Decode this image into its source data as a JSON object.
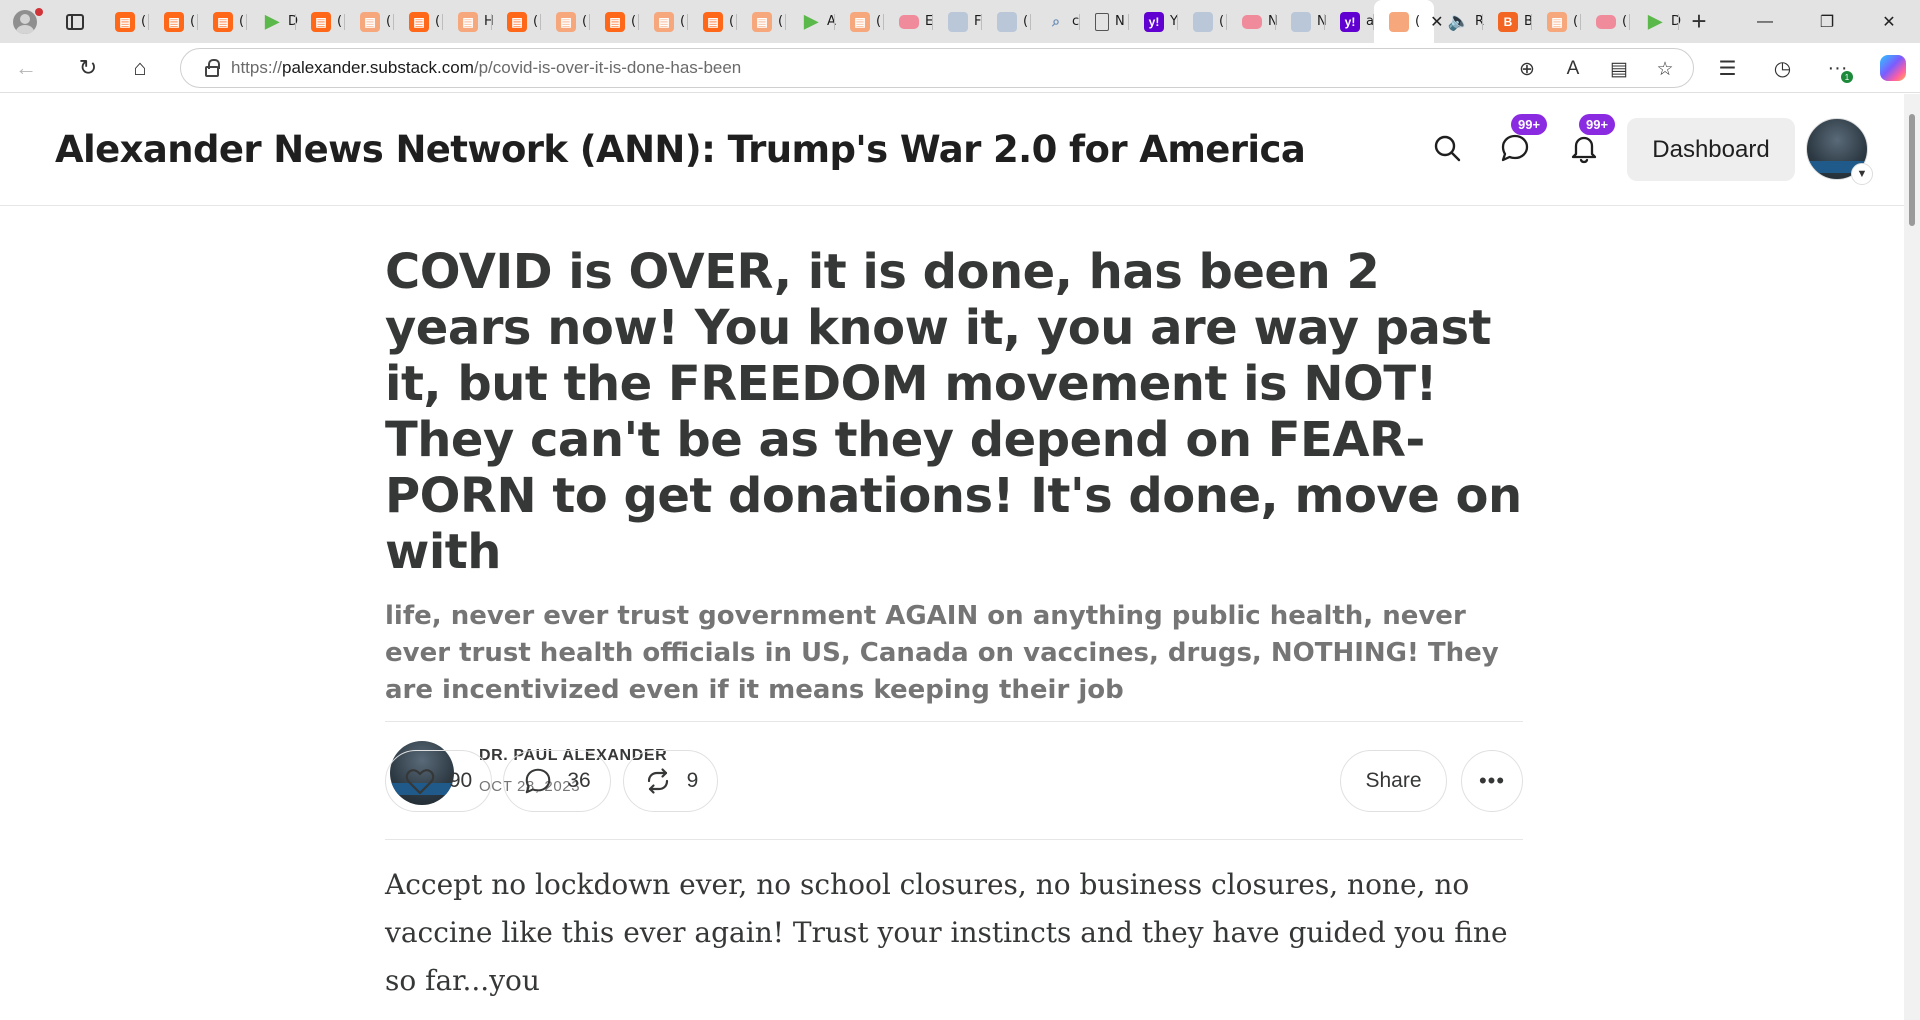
{
  "browser": {
    "tabs": [
      {
        "icon": "substack-icon",
        "letter": "("
      },
      {
        "icon": "substack-icon",
        "letter": "("
      },
      {
        "icon": "substack-icon",
        "letter": "("
      },
      {
        "icon": "play-icon",
        "letter": "D"
      },
      {
        "icon": "substack-icon",
        "letter": "("
      },
      {
        "icon": "substack-icon",
        "letter": "("
      },
      {
        "icon": "substack-icon",
        "letter": "("
      },
      {
        "icon": "substack-icon",
        "letter": "H"
      },
      {
        "icon": "substack-icon",
        "letter": "("
      },
      {
        "icon": "substack-icon",
        "letter": "("
      },
      {
        "icon": "substack-icon",
        "letter": "("
      },
      {
        "icon": "substack-icon",
        "letter": "("
      },
      {
        "icon": "substack-icon",
        "letter": "("
      },
      {
        "icon": "substack-icon",
        "letter": "("
      },
      {
        "icon": "play-icon",
        "letter": "A"
      },
      {
        "icon": "substack-icon",
        "letter": "("
      },
      {
        "icon": "youtube-icon",
        "letter": "E"
      },
      {
        "icon": "news-icon",
        "letter": "F"
      },
      {
        "icon": "music-icon",
        "letter": "("
      },
      {
        "icon": "search-icon",
        "letter": "c"
      },
      {
        "icon": "document-icon",
        "letter": "N"
      },
      {
        "icon": "yahoo-icon",
        "letter": "Y"
      },
      {
        "icon": "mail-icon",
        "letter": "("
      },
      {
        "icon": "youtube-icon",
        "letter": "N"
      },
      {
        "icon": "grid-icon",
        "letter": "N"
      },
      {
        "icon": "yahoo-icon",
        "letter": "a"
      },
      {
        "icon": "close-icon",
        "letter": "("
      },
      {
        "icon": "speaker-icon",
        "letter": "R"
      },
      {
        "icon": "blogger-icon",
        "letter": "B"
      },
      {
        "icon": "substack-icon",
        "letter": "("
      },
      {
        "icon": "youtube-icon",
        "letter": "("
      },
      {
        "icon": "play-icon",
        "letter": "D"
      }
    ],
    "active_tab_index": 26,
    "url_prefix": "https://",
    "url_host": "palexander.substack.com",
    "url_path": "/p/covid-is-over-it-is-done-has-been",
    "extensions_badge": "1"
  },
  "site": {
    "title": "Alexander News Network (ANN): Trump's War 2.0 for America",
    "chat_badge": "99+",
    "notifications_badge": "99+",
    "dashboard_label": "Dashboard"
  },
  "post": {
    "title": "COVID is OVER, it is done, has been 2 years now! You know it, you are way past it, but the FREEDOM movement is NOT! They can't be as they depend on FEAR-PORN to get donations! It's done, move on with",
    "subtitle": "life, never ever trust government AGAIN on anything public health, never ever trust health officials in US, Canada on vaccines, drugs, NOTHING! They are incentivized even if it means keeping their job",
    "author": "DR. PAUL ALEXANDER",
    "date": "OCT 28, 2023",
    "likes": "90",
    "comments": "36",
    "restacks": "9",
    "share_label": "Share",
    "more_label": "•••",
    "body": "Accept no lockdown ever, no school closures, no business closures, none, no vaccine like this ever again! Trust your instincts and they have guided you fine so far...you"
  },
  "colors": {
    "substack_orange": "#ff6719",
    "badge_purple": "#8a2be2",
    "text": "#363737",
    "muted": "#757575"
  }
}
